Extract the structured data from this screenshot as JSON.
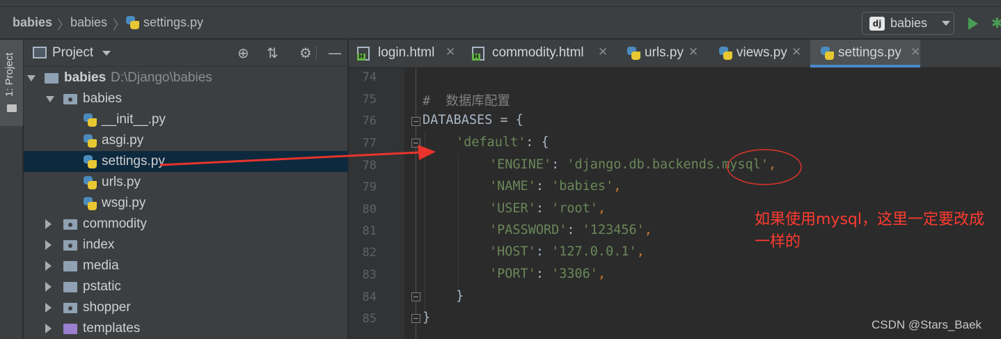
{
  "breadcrumb": {
    "project": "babies",
    "folder": "babies",
    "file": "settings.py"
  },
  "run_config": {
    "icon_text": "dj",
    "label": "babies"
  },
  "tool_window": {
    "vertical_label": "1: Project"
  },
  "project_panel": {
    "title": "Project",
    "root": {
      "name": "babies",
      "path": "D:\\Django\\babies"
    },
    "package": {
      "name": "babies"
    },
    "files": [
      "__init__.py",
      "asgi.py",
      "settings.py",
      "urls.py",
      "wsgi.py"
    ],
    "selected_file": "settings.py",
    "folders": [
      "commodity",
      "index",
      "media",
      "pstatic",
      "shopper",
      "templates"
    ]
  },
  "editor_tabs": [
    {
      "label": "login.html",
      "type": "html"
    },
    {
      "label": "commodity.html",
      "type": "html"
    },
    {
      "label": "urls.py",
      "type": "python"
    },
    {
      "label": "views.py",
      "type": "python"
    },
    {
      "label": "settings.py",
      "type": "python",
      "active": true
    }
  ],
  "code": {
    "line_numbers": [
      "74",
      "75",
      "76",
      "77",
      "78",
      "79",
      "80",
      "81",
      "82",
      "83",
      "84",
      "85"
    ],
    "comment": "#  数据库配置",
    "databases_head": "DATABASES = {",
    "default_key": "'default'",
    "default_tail": ": {",
    "entries": [
      {
        "key": "'ENGINE'",
        "value": "'django.db.backends.mysql'"
      },
      {
        "key": "'NAME'",
        "value": "'babies'"
      },
      {
        "key": "'USER'",
        "value": "'root'"
      },
      {
        "key": "'PASSWORD'",
        "value": "'123456'"
      },
      {
        "key": "'HOST'",
        "value": "'127.0.0.1'"
      },
      {
        "key": "'PORT'",
        "value": "'3306'"
      }
    ],
    "inner_close": "}",
    "outer_close": "}"
  },
  "annotation": {
    "text": "如果使用mysql，这里一定要改成一样的",
    "color": "#ff3b30"
  },
  "watermark": "CSDN @Stars_Baek",
  "colors": {
    "background": "#2b2b2b",
    "panel": "#3c3f41",
    "selection": "#0d293e",
    "string": "#6a8759",
    "keyword_operator": "#cc7832",
    "comment": "#808080",
    "accent": "#4a88c7",
    "run_green": "#499c54",
    "annotation_red": "#ff3b30"
  }
}
